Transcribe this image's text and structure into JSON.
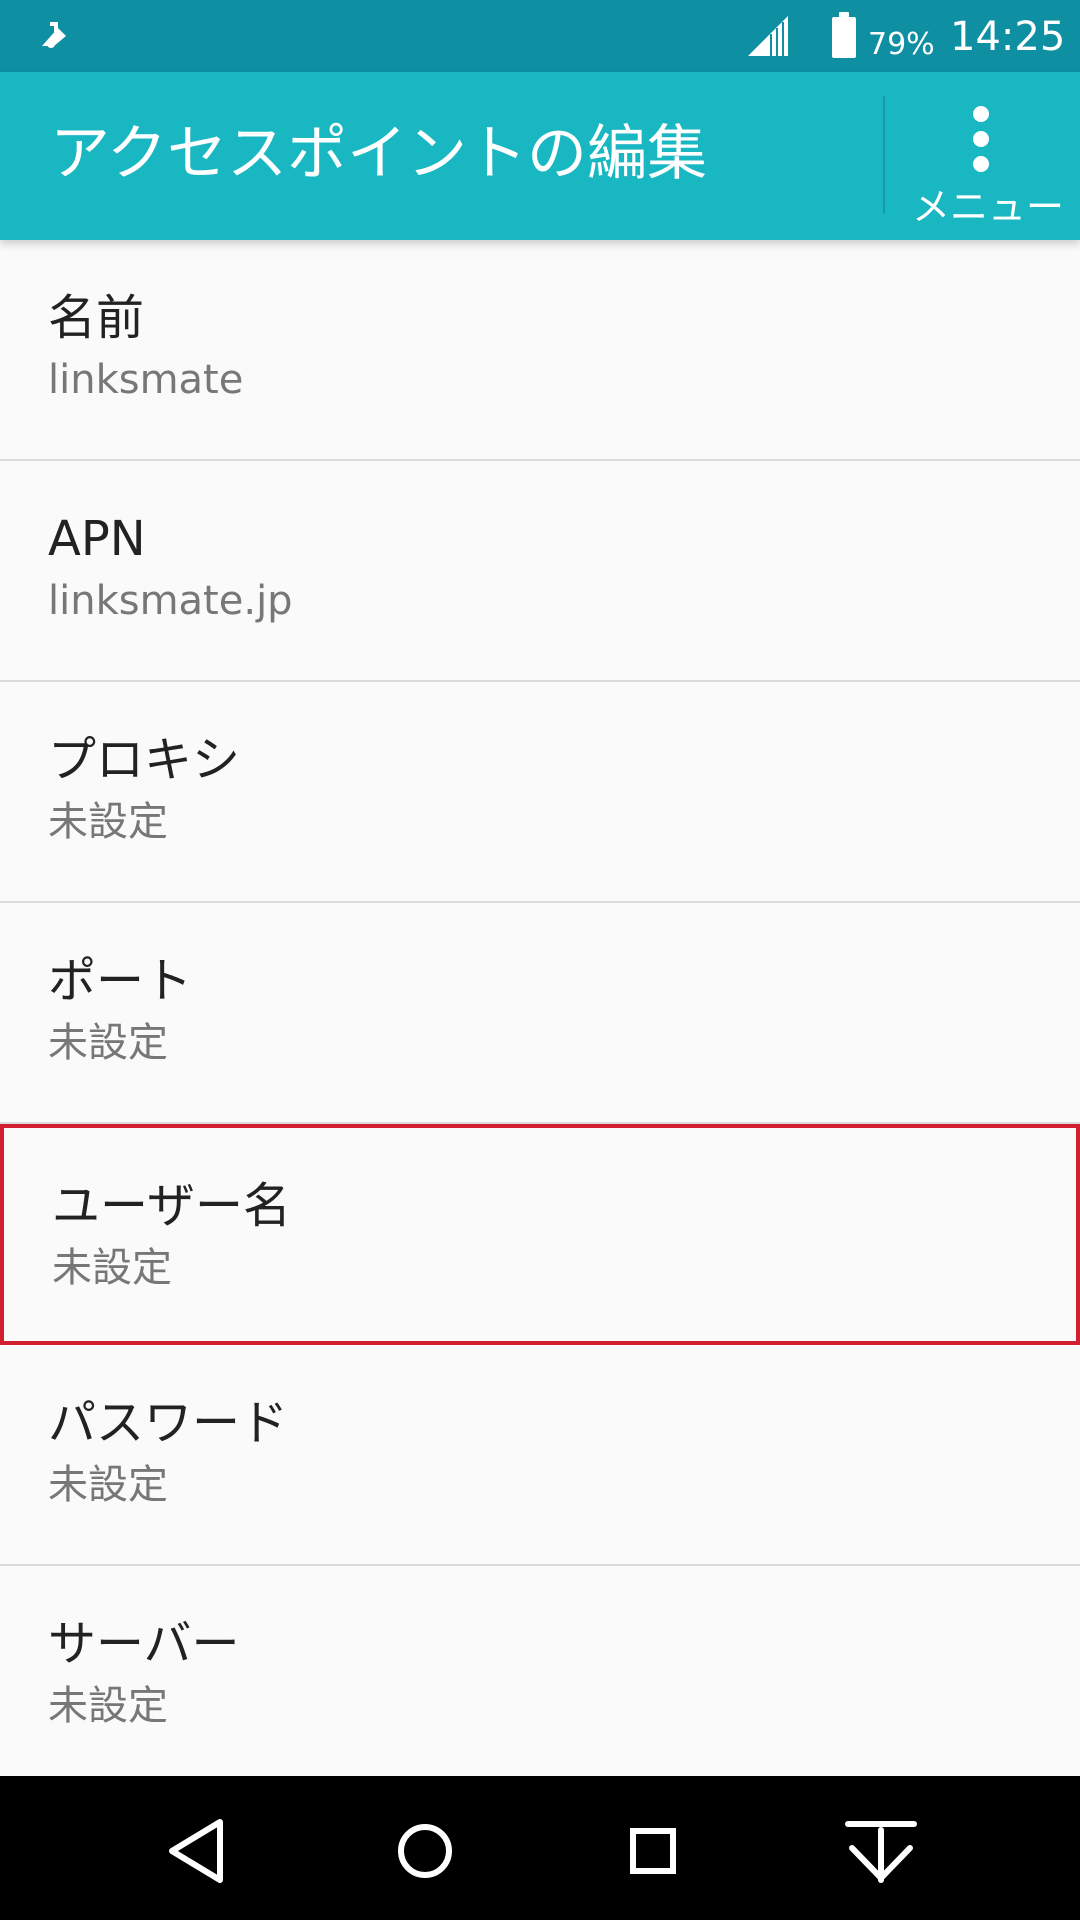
{
  "status": {
    "battery": "79%",
    "time": "14:25",
    "icons": [
      "notification-icon",
      "signal-icon",
      "battery-icon"
    ]
  },
  "appbar": {
    "title": "アクセスポイントの編集",
    "menu_label": "メニュー"
  },
  "items": [
    {
      "title": "名前",
      "value": "linksmate"
    },
    {
      "title": "APN",
      "value": "linksmate.jp"
    },
    {
      "title": "プロキシ",
      "value": "未設定"
    },
    {
      "title": "ポート",
      "value": "未設定"
    },
    {
      "title": "ユーザー名",
      "value": "未設定"
    },
    {
      "title": "パスワード",
      "value": "未設定"
    },
    {
      "title": "サーバー",
      "value": "未設定"
    }
  ],
  "colors": {
    "statusbar": "#0e8fa2",
    "appbar": "#18b7c2",
    "highlight": "#d21f2f"
  },
  "navigation": [
    "back-icon",
    "home-icon",
    "recent-apps-icon",
    "collapse-icon"
  ]
}
